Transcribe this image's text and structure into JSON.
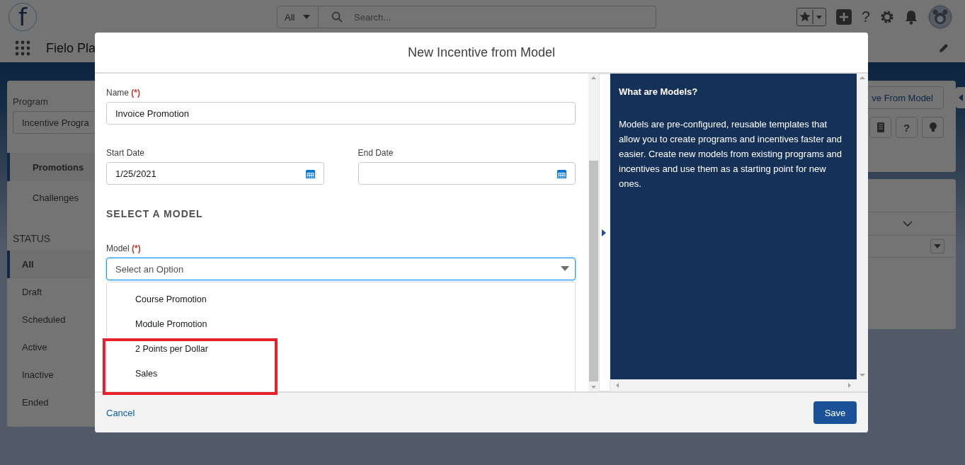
{
  "header": {
    "logo_letter": "f",
    "scope": "All",
    "search_placeholder": "Search...",
    "help_glyph": "?"
  },
  "nav": {
    "app_name": "Fielo Pla"
  },
  "program_panel": {
    "label": "Program",
    "value": "Incentive Progra",
    "sections": [
      {
        "label": "Promotions",
        "selected": true
      },
      {
        "label": "Challenges",
        "selected": false
      }
    ],
    "status_heading": "STATUS",
    "statuses": [
      {
        "label": "All",
        "selected": true
      },
      {
        "label": "Draft",
        "selected": false
      },
      {
        "label": "Scheduled",
        "selected": false
      },
      {
        "label": "Active",
        "selected": false
      },
      {
        "label": "Inactive",
        "selected": false
      },
      {
        "label": "Ended",
        "selected": false
      }
    ]
  },
  "right_panel": {
    "button": "ve From Model",
    "help_glyph": "?"
  },
  "modal": {
    "title": "New Incentive from Model",
    "name": {
      "label": "Name",
      "required_mark": "(*)",
      "value": "Invoice Promotion"
    },
    "start_date": {
      "label": "Start Date",
      "value": "1/25/2021"
    },
    "end_date": {
      "label": "End Date"
    },
    "section_heading": "SELECT A MODEL",
    "model": {
      "label": "Model",
      "required_mark": "(*)",
      "placeholder": "Select an Option",
      "expanded": true,
      "options": [
        {
          "label": "Course Promotion",
          "selected": false
        },
        {
          "label": "Module Promotion",
          "selected": false
        },
        {
          "label": "2 Points per Dollar",
          "selected": false
        },
        {
          "label": "Sales",
          "selected": false
        }
      ]
    },
    "info": {
      "title": "What are Models?",
      "text": "Models are pre-configured, reusable templates that allow you to create programs and incentives faster and easier. Create new models from existing programs and incentives and use them as a starting point for new ones."
    },
    "cancel": "Cancel",
    "save": "Save"
  }
}
